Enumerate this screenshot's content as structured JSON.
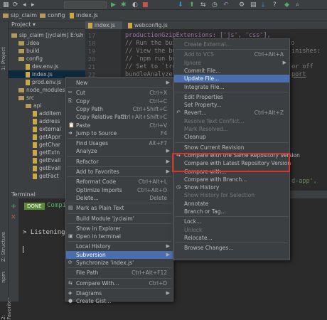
{
  "breadcrumbs": [
    "sip_claim",
    "config",
    "index.js"
  ],
  "left_strip": {
    "project_label": "1: Project",
    "structure_label": "Z: Structure",
    "npm_label": "npm",
    "favorites_label": "2: Favorites"
  },
  "project_panel": {
    "header": "Project",
    "rows": [
      {
        "label": "sip_claim [jyclaim] E:\\sh",
        "type": "folder"
      },
      {
        "label": ".idea",
        "type": "folder"
      },
      {
        "label": "build",
        "type": "folder"
      },
      {
        "label": "config",
        "type": "folder"
      },
      {
        "label": "dev.env.js",
        "type": "js"
      },
      {
        "label": "index.js",
        "type": "js"
      },
      {
        "label": "prod.env.js",
        "type": "js"
      },
      {
        "label": "node_modules lib",
        "type": "folder"
      },
      {
        "label": "src",
        "type": "folder"
      },
      {
        "label": "api",
        "type": "folder"
      },
      {
        "label": "addItem",
        "type": "js"
      },
      {
        "label": "address",
        "type": "js"
      },
      {
        "label": "external",
        "type": "js"
      },
      {
        "label": "getAppr",
        "type": "js"
      },
      {
        "label": "getChar",
        "type": "js"
      },
      {
        "label": "getExtn",
        "type": "js"
      },
      {
        "label": "getEvall",
        "type": "js"
      },
      {
        "label": "getEvall",
        "type": "js"
      },
      {
        "label": "getFact",
        "type": "js"
      }
    ]
  },
  "editor": {
    "tabs": [
      "index.js",
      "webconfig.js"
    ],
    "line_numbers": [
      "17",
      "18",
      "19",
      "20",
      "21",
      "22"
    ],
    "lines": [
      "productionGzipExtensions: ['js', 'css'],",
      "// Run the buil",
      "// View the bu",
      "// `npm run bu",
      "// Set to `tru",
      "bundleAnalyzer"
    ],
    "right_fragments": [
      "to",
      "inishes:",
      "or off",
      "port",
      "d-app',"
    ]
  },
  "terminal": {
    "title": "Terminal",
    "badge": "DONE",
    "compile_text": "Compil",
    "listening_text": "> Listening a"
  },
  "context_menu": [
    {
      "label": "New",
      "shortcut": "",
      "arrow": true
    },
    {
      "sep": true
    },
    {
      "label": "Cut",
      "shortcut": "Ctrl+X",
      "icon": "✂"
    },
    {
      "label": "Copy",
      "shortcut": "Ctrl+C",
      "icon": "⎘"
    },
    {
      "label": "Copy Path",
      "shortcut": "Ctrl+Shift+C"
    },
    {
      "label": "Copy Relative Path",
      "shortcut": "Ctrl+Alt+Shift+C"
    },
    {
      "label": "Paste",
      "shortcut": "Ctrl+V",
      "icon": "📋"
    },
    {
      "label": "Jump to Source",
      "shortcut": "F4",
      "icon": "➜"
    },
    {
      "sep": true
    },
    {
      "label": "Find Usages",
      "shortcut": "Alt+F7"
    },
    {
      "label": "Analyze",
      "shortcut": "",
      "arrow": true
    },
    {
      "sep": true
    },
    {
      "label": "Refactor",
      "shortcut": "",
      "arrow": true
    },
    {
      "sep": true
    },
    {
      "label": "Add to Favorites",
      "shortcut": "",
      "arrow": true
    },
    {
      "sep": true
    },
    {
      "label": "Reformat Code",
      "shortcut": "Ctrl+Alt+L"
    },
    {
      "label": "Optimize Imports",
      "shortcut": "Ctrl+Alt+O"
    },
    {
      "label": "Delete...",
      "shortcut": "Delete"
    },
    {
      "sep": true
    },
    {
      "label": "Mark as Plain Text",
      "shortcut": "",
      "icon": "▤"
    },
    {
      "sep": true
    },
    {
      "label": "Build Module 'jyclaim'",
      "shortcut": ""
    },
    {
      "sep": true
    },
    {
      "label": "Show in Explorer",
      "shortcut": ""
    },
    {
      "label": "Open in terminal",
      "shortcut": "",
      "icon": "▣"
    },
    {
      "sep": true
    },
    {
      "label": "Local History",
      "shortcut": "",
      "arrow": true
    },
    {
      "label": "Subversion",
      "shortcut": "",
      "arrow": true,
      "selected": true
    },
    {
      "label": "Synchronize 'index.js'",
      "shortcut": "",
      "icon": "⟳"
    },
    {
      "sep": true
    },
    {
      "label": "File Path",
      "shortcut": "Ctrl+Alt+F12"
    },
    {
      "sep": true
    },
    {
      "label": "Compare With...",
      "shortcut": "Ctrl+D",
      "icon": "⇆"
    },
    {
      "sep": true
    },
    {
      "label": "Diagrams",
      "shortcut": "",
      "arrow": true,
      "icon": "◈"
    },
    {
      "label": "Create Gist...",
      "shortcut": "",
      "icon": "●"
    }
  ],
  "submenu": [
    {
      "label": "Create External...",
      "shortcut": "",
      "disabled": true
    },
    {
      "sep": true
    },
    {
      "label": "Add to VCS",
      "shortcut": "Ctrl+Alt+A",
      "disabled": true
    },
    {
      "label": "Ignore",
      "shortcut": "",
      "arrow": true,
      "disabled": true
    },
    {
      "label": "Commit File...",
      "shortcut": ""
    },
    {
      "label": "Update File...",
      "shortcut": "",
      "selected": true
    },
    {
      "label": "Integrate File...",
      "shortcut": ""
    },
    {
      "sep": true
    },
    {
      "label": "Edit Properties",
      "shortcut": ""
    },
    {
      "label": "Set Property...",
      "shortcut": ""
    },
    {
      "label": "Revert...",
      "shortcut": "Ctrl+Alt+Z",
      "icon": "↶"
    },
    {
      "label": "Resolve Text Conflict...",
      "shortcut": "",
      "disabled": true
    },
    {
      "label": "Mark Resolved...",
      "shortcut": "",
      "disabled": true
    },
    {
      "label": "Cleanup",
      "shortcut": ""
    },
    {
      "sep": true
    },
    {
      "label": "Show Current Revision",
      "shortcut": ""
    },
    {
      "label": "Compare with the Same Repository Version",
      "shortcut": "",
      "icon": "⇆"
    },
    {
      "label": "Compare with Latest Repository Version",
      "shortcut": ""
    },
    {
      "label": "Compare with...",
      "shortcut": ""
    },
    {
      "label": "Compare with Branch...",
      "shortcut": ""
    },
    {
      "label": "Show History",
      "shortcut": "",
      "icon": "◷"
    },
    {
      "label": "Show History for Selection",
      "shortcut": "",
      "disabled": true
    },
    {
      "label": "Annotate",
      "shortcut": ""
    },
    {
      "label": "Branch or Tag...",
      "shortcut": ""
    },
    {
      "sep": true
    },
    {
      "label": "Lock...",
      "shortcut": ""
    },
    {
      "label": "Unlock",
      "shortcut": "",
      "disabled": true
    },
    {
      "label": "Relocate...",
      "shortcut": ""
    },
    {
      "sep": true
    },
    {
      "label": "Browse Changes...",
      "shortcut": ""
    }
  ],
  "colors": {
    "selection": "#4b6eaf",
    "highlight_border": "#d9332d",
    "done_badge": "#5d8a3a"
  }
}
